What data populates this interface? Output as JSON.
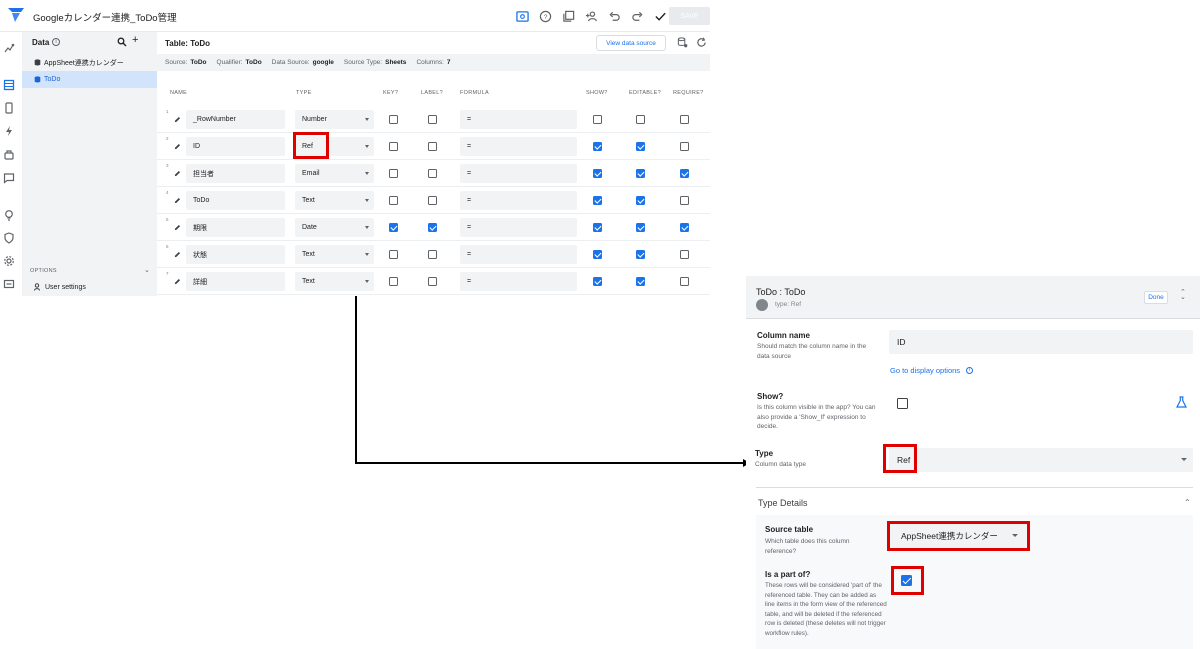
{
  "app": {
    "title": "Googleカレンダー連携_ToDo管理",
    "save_label": "SAVE"
  },
  "data_panel": {
    "title": "Data",
    "items": [
      {
        "label": "AppSheet連携カレンダー"
      },
      {
        "label": "ToDo"
      }
    ],
    "options_label": "OPTIONS",
    "user_settings_label": "User settings"
  },
  "table_editor": {
    "title": "Table: ToDo",
    "view_source_label": "View data source",
    "meta": {
      "source_label": "Source:",
      "source": "ToDo",
      "qualifier_label": "Qualifier:",
      "qualifier": "ToDo",
      "datasource_label": "Data Source:",
      "datasource": "google",
      "sourcetype_label": "Source Type:",
      "sourcetype": "Sheets",
      "columns_label": "Columns:",
      "columns": "7"
    },
    "headers": {
      "name": "NAME",
      "type": "TYPE",
      "key": "KEY?",
      "label": "LABEL?",
      "formula": "FORMULA",
      "show": "SHOW?",
      "editable": "EDITABLE?",
      "require": "REQUIRE?"
    },
    "rows": [
      {
        "num": "1",
        "name": "_RowNumber",
        "type": "Number",
        "formula": "=",
        "key": false,
        "label": false,
        "show": false,
        "editable": false,
        "require": false
      },
      {
        "num": "2",
        "name": "ID",
        "type": "Ref",
        "formula": "=",
        "key": false,
        "label": false,
        "show": true,
        "editable": true,
        "require": false
      },
      {
        "num": "3",
        "name": "担当者",
        "type": "Email",
        "formula": "=",
        "key": false,
        "label": false,
        "show": true,
        "editable": true,
        "require": true
      },
      {
        "num": "4",
        "name": "ToDo",
        "type": "Text",
        "formula": "=",
        "key": false,
        "label": false,
        "show": true,
        "editable": true,
        "require": false
      },
      {
        "num": "5",
        "name": "期限",
        "type": "Date",
        "formula": "=",
        "key": true,
        "label": true,
        "show": true,
        "editable": true,
        "require": true
      },
      {
        "num": "6",
        "name": "状態",
        "type": "Text",
        "formula": "=",
        "key": false,
        "label": false,
        "show": true,
        "editable": true,
        "require": false
      },
      {
        "num": "7",
        "name": "詳細",
        "type": "Text",
        "formula": "=",
        "key": false,
        "label": false,
        "show": true,
        "editable": true,
        "require": false
      }
    ]
  },
  "detail": {
    "title": "ToDo : ToDo",
    "subtitle": "type: Ref",
    "done_label": "Done",
    "column_name": {
      "label": "Column name",
      "desc": "Should match the column name in the data source",
      "value": "ID"
    },
    "goto_display": "Go to display options",
    "show": {
      "label": "Show?",
      "desc": "Is this column visible in the app? You can also provide a 'Show_If' expression to decide.",
      "checked": false
    },
    "type": {
      "label": "Type",
      "desc": "Column data type",
      "value": "Ref"
    },
    "type_details": "Type Details",
    "source_table": {
      "label": "Source table",
      "desc": "Which table does this column reference?",
      "value": "AppSheet連携カレンダー"
    },
    "is_part_of": {
      "label": "Is a part of?",
      "desc": "These rows will be considered 'part of' the referenced table. They can be added as line items in the form view of the referenced table, and will be deleted if the referenced row is deleted (these deletes will not trigger workflow rules).",
      "checked": true
    }
  },
  "colors": {
    "accent": "#1a73e8",
    "highlight": "#e00000",
    "panel": "#f1f3f4"
  }
}
